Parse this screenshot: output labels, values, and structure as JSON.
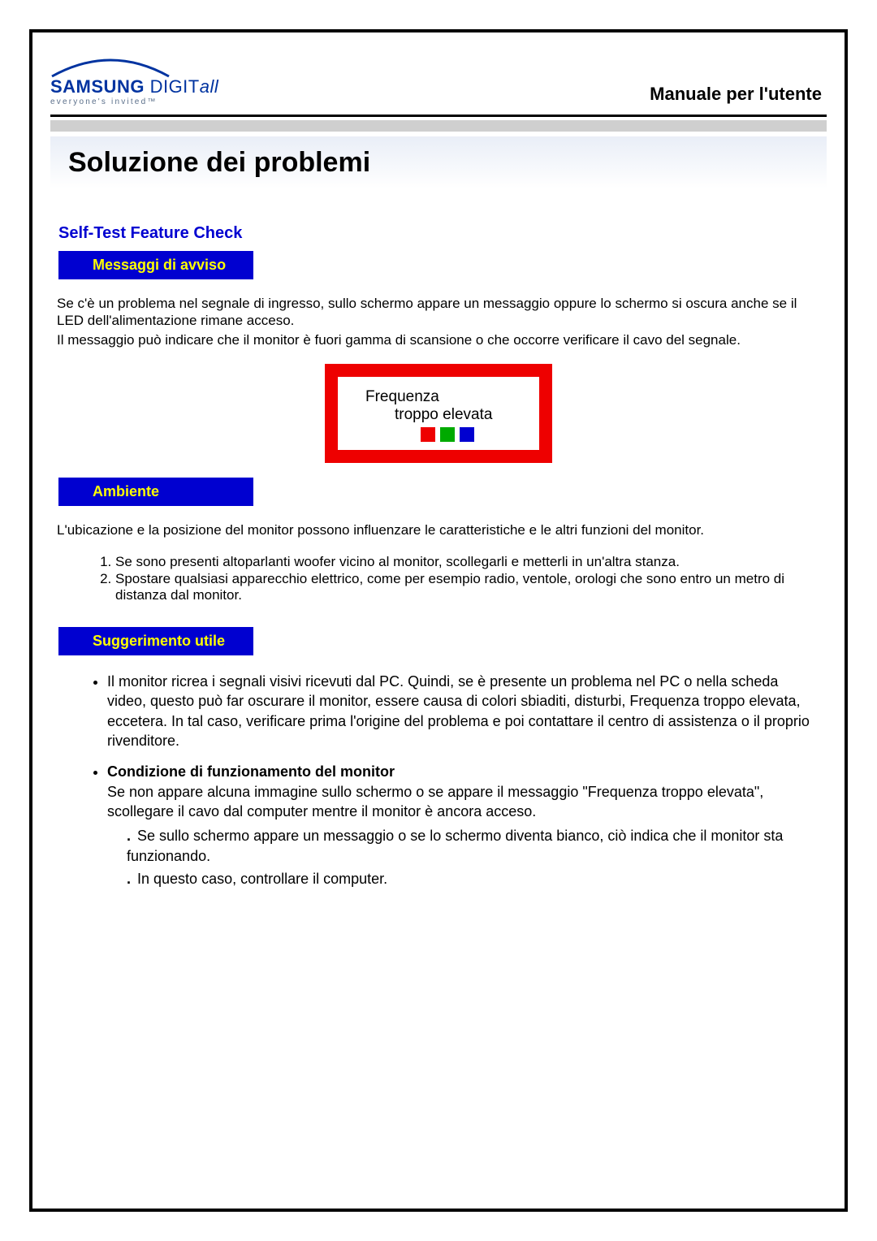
{
  "logo": {
    "brand_strong": "SAMSUNG",
    "brand_suffix": " DIGIT",
    "brand_ital": "all",
    "tagline": "everyone's invited™"
  },
  "header_title": "Manuale per l'utente",
  "page_title": "Soluzione dei problemi",
  "section_label": "Self-Test Feature Check",
  "sections": {
    "messaggi": {
      "heading": "Messaggi di avviso",
      "para1": "Se c'è un problema nel segnale di ingresso, sullo schermo appare un messaggio oppure lo schermo si oscura anche se il LED dell'alimentazione rimane acceso.",
      "para2": "Il messaggio può indicare che il monitor è fuori gamma di scansione o che occorre verificare il cavo del segnale."
    },
    "warning": {
      "line1": "Frequenza",
      "line2": "troppo elevata"
    },
    "ambiente": {
      "heading": "Ambiente",
      "para": "L'ubicazione e la posizione del monitor possono influenzare le caratteristiche e le altri funzioni del monitor.",
      "list": [
        "Se sono presenti altoparlanti woofer vicino al monitor, scollegarli e metterli in un'altra stanza.",
        "Spostare qualsiasi apparecchio elettrico, come per esempio radio, ventole, orologi che sono entro un metro di distanza dal monitor."
      ]
    },
    "suggerimento": {
      "heading": "Suggerimento utile",
      "b1": "Il monitor ricrea i segnali visivi ricevuti dal PC. Quindi, se è presente un problema nel PC o nella scheda video, questo può far oscurare il monitor, essere causa di colori sbiaditi, disturbi, Frequenza troppo elevata, eccetera. In tal caso, verificare prima l'origine del problema e poi contattare il centro di assistenza o il proprio rivenditore.",
      "b2_title": "Condizione di funzionamento del monitor",
      "b2_body": "Se non appare alcuna immagine sullo schermo o se appare il messaggio \"Frequenza troppo elevata\", scollegare il cavo dal computer mentre il monitor è ancora acceso.",
      "b2_sub": [
        "Se sullo schermo appare un messaggio o se lo schermo diventa bianco, ciò indica che il monitor sta funzionando.",
        "In questo caso, controllare il computer."
      ]
    }
  }
}
